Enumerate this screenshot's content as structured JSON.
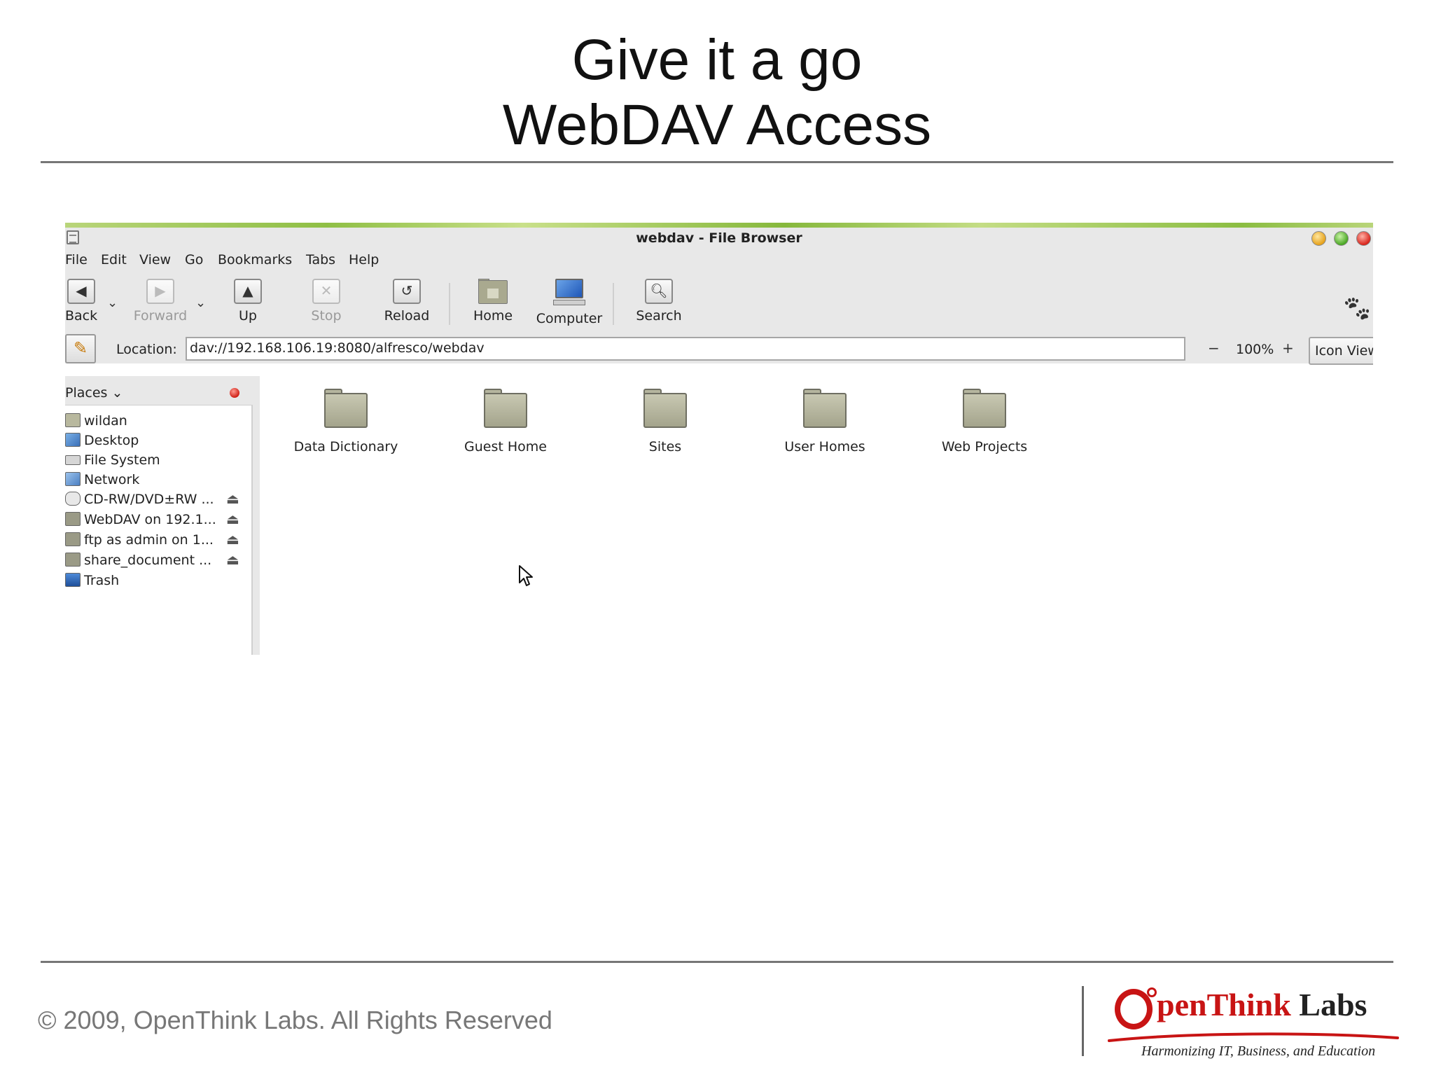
{
  "slide": {
    "title_line1": "Give it a go",
    "title_line2": "WebDAV Access",
    "copyright": "© 2009, OpenThink Labs. All Rights Reserved",
    "logo": {
      "name_main": "penThink",
      "name_labs": "Labs",
      "tagline": "Harmonizing IT, Business, and Education",
      "color": "#c81414"
    }
  },
  "window": {
    "title": "webdav - File Browser",
    "menu": [
      "File",
      "Edit",
      "View",
      "Go",
      "Bookmarks",
      "Tabs",
      "Help"
    ],
    "toolbar": {
      "back": "Back",
      "forward": "Forward",
      "up": "Up",
      "stop": "Stop",
      "reload": "Reload",
      "home": "Home",
      "computer": "Computer",
      "search": "Search"
    },
    "location": {
      "label": "Location:",
      "value": "dav://192.168.106.19:8080/alfresco/webdav"
    },
    "zoom": {
      "out": "−",
      "level": "100%",
      "in": "+"
    },
    "view_mode": "Icon View",
    "sidebar": {
      "header": "Places",
      "items": [
        {
          "label": "wildan",
          "icon": "home-folder-icon",
          "eject": false
        },
        {
          "label": "Desktop",
          "icon": "desktop-icon",
          "eject": false
        },
        {
          "label": "File System",
          "icon": "harddisk-icon",
          "eject": false
        },
        {
          "label": "Network",
          "icon": "network-icon",
          "eject": false
        },
        {
          "label": "CD-RW/DVD±RW ...",
          "icon": "optical-drive-icon",
          "eject": true
        },
        {
          "label": "WebDAV on 192.1...",
          "icon": "network-share-icon",
          "eject": true
        },
        {
          "label": "ftp as admin on 1...",
          "icon": "network-share-icon",
          "eject": true
        },
        {
          "label": "share_document ...",
          "icon": "network-share-icon",
          "eject": true
        },
        {
          "label": "Trash",
          "icon": "trash-icon",
          "eject": false
        }
      ]
    },
    "folders": [
      "Data Dictionary",
      "Guest Home",
      "Sites",
      "User Homes",
      "Web Projects"
    ]
  }
}
